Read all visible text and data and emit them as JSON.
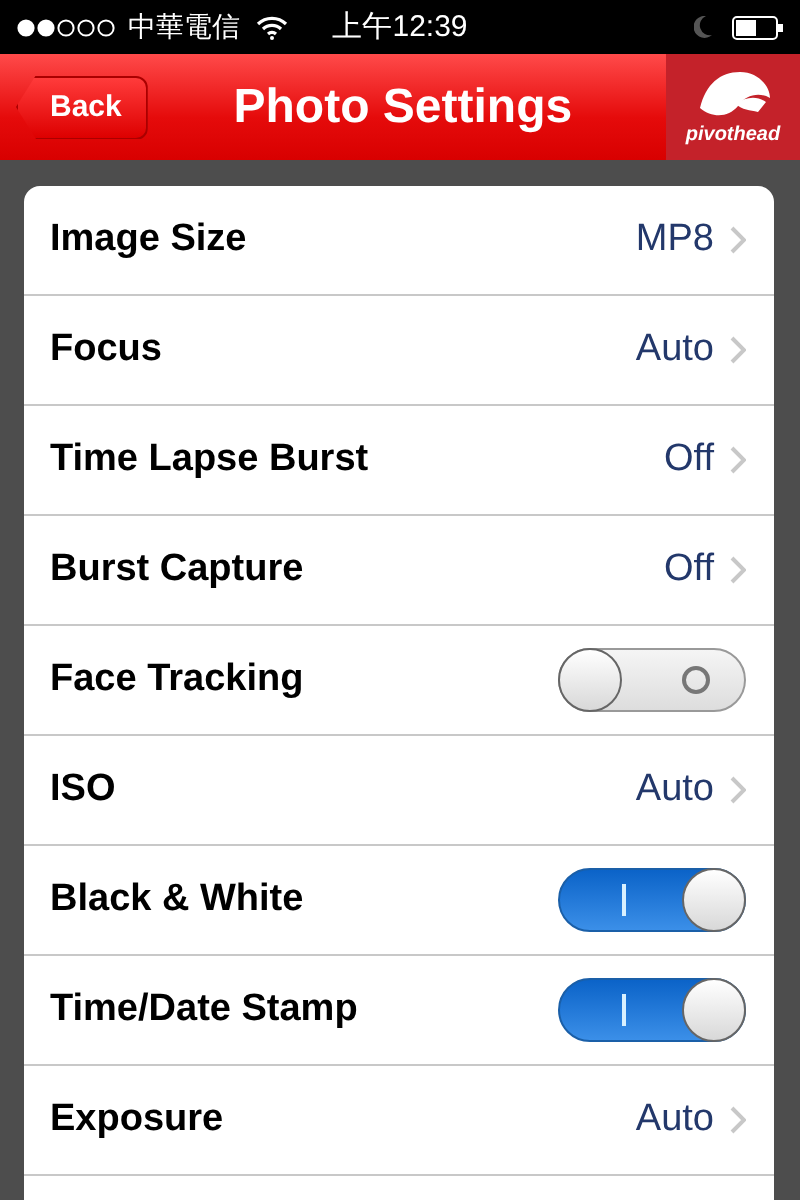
{
  "status_bar": {
    "carrier": "中華電信",
    "time": "上午12:39"
  },
  "nav_bar": {
    "back": "Back",
    "title": "Photo Settings",
    "logo": "pivothead"
  },
  "settings": [
    {
      "label": "Image Size",
      "kind": "value",
      "value": "MP8"
    },
    {
      "label": "Focus",
      "kind": "value",
      "value": "Auto"
    },
    {
      "label": "Time Lapse Burst",
      "kind": "value",
      "value": "Off"
    },
    {
      "label": "Burst Capture",
      "kind": "value",
      "value": "Off"
    },
    {
      "label": "Face Tracking",
      "kind": "toggle",
      "on": false
    },
    {
      "label": "ISO",
      "kind": "value",
      "value": "Auto"
    },
    {
      "label": "Black & White",
      "kind": "toggle",
      "on": true
    },
    {
      "label": "Time/Date Stamp",
      "kind": "toggle",
      "on": true
    },
    {
      "label": "Exposure",
      "kind": "value",
      "value": "Auto"
    }
  ]
}
